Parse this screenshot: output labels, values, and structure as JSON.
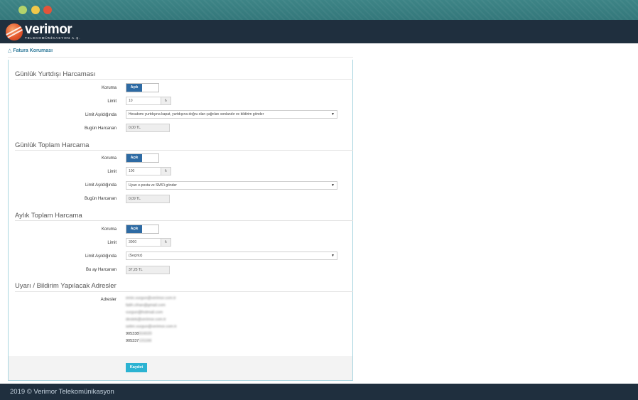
{
  "window": {
    "controls": [
      "green-dot",
      "yellow-dot",
      "red-dot"
    ]
  },
  "brand": {
    "name": "verimor",
    "tagline": "TELEKOMÜNİKASYON A.Ş."
  },
  "breadcrumb": {
    "label": "Fatura Koruması",
    "icon": "shield-icon"
  },
  "sections": [
    {
      "title": "Günlük Yurtdışı Harcaması",
      "koruma_label": "Koruma",
      "toggle": "Açık",
      "limit_label": "Limit",
      "limit_value": "10",
      "currency": "₺",
      "exceed_label": "Limit Aşıldığında",
      "exceed_value": "Hesabımı yurtdışına kapat, yurtdışına doğru olan çağrıları sonlandır ve bildirim gönder",
      "spent_label": "Bugün Harcanan",
      "spent_value": "0,00 TL"
    },
    {
      "title": "Günlük Toplam Harcama",
      "koruma_label": "Koruma",
      "toggle": "Açık",
      "limit_label": "Limit",
      "limit_value": "100",
      "currency": "₺",
      "exceed_label": "Limit Aşıldığında",
      "exceed_value": "Uyarı e-posta ve SMS'i gönder",
      "spent_label": "Bugün Harcanan",
      "spent_value": "0,09 TL"
    },
    {
      "title": "Aylık Toplam Harcama",
      "koruma_label": "Koruma",
      "toggle": "Açık",
      "limit_label": "Limit",
      "limit_value": "3000",
      "currency": "₺",
      "exceed_label": "Limit Aşıldığında",
      "exceed_value": "(Seçiniz)",
      "spent_label": "Bu ay Harcanan",
      "spent_value": "37,25 TL"
    }
  ],
  "addresses": {
    "title": "Uyarı / Bildirim Yapılacak Adresler",
    "label": "Adresler",
    "items": [
      "emin.vurgun@verimor.com.tr",
      "fatih.cihan@gmail.com",
      "vurgun@hotmail.com",
      "destek@verimor.com.tr",
      "selim.vurgun@verimor.com.tr",
      "905338",
      "905337"
    ]
  },
  "save_label": "Kaydet",
  "footer": {
    "text": "2019 © Verimor Telekomünikasyon"
  }
}
